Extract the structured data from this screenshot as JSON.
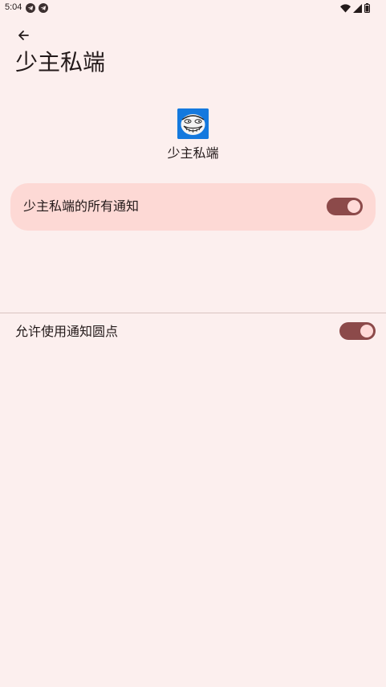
{
  "status_bar": {
    "time": "5:04",
    "left_icons": [
      "telegram-icon",
      "telegram-icon"
    ],
    "right_icons": [
      "wifi-icon",
      "signal-icon",
      "battery-icon"
    ]
  },
  "header": {
    "back_icon": "arrow-back-icon",
    "title": "少主私端"
  },
  "app": {
    "name": "少主私端",
    "icon": "app-trollface-icon"
  },
  "all_notifications": {
    "label": "少主私端的所有通知",
    "enabled": true
  },
  "notification_dots": {
    "label": "允许使用通知圆点",
    "enabled": true
  },
  "colors": {
    "background": "#fcefee",
    "card": "#fdd9d5",
    "switch_track": "#8c4a4a",
    "switch_thumb": "#ffdad8"
  }
}
